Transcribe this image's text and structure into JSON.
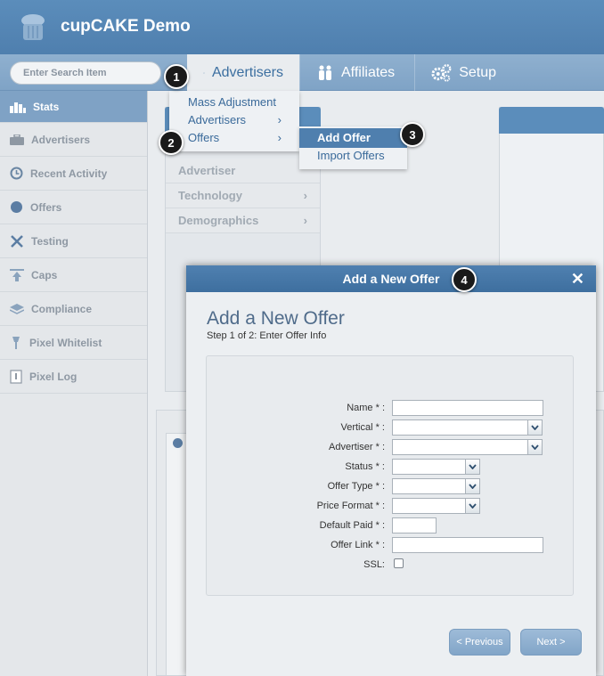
{
  "header": {
    "title": "cupCAKE Demo"
  },
  "navbar": {
    "search_placeholder": "Enter Search Item",
    "tabs": [
      {
        "label": "Advertisers",
        "icon": "megaphone-icon",
        "active": true
      },
      {
        "label": "Affiliates",
        "icon": "people-icon",
        "active": false
      },
      {
        "label": "Setup",
        "icon": "gears-icon",
        "active": false
      }
    ]
  },
  "sidebar": {
    "items": [
      {
        "label": "Stats",
        "icon": "bar-chart-icon",
        "active": true
      },
      {
        "label": "Advertisers",
        "icon": "briefcase-icon"
      },
      {
        "label": "Recent Activity",
        "icon": "clock-icon"
      },
      {
        "label": "Offers",
        "icon": "circle-icon"
      },
      {
        "label": "Testing",
        "icon": "tools-icon"
      },
      {
        "label": "Caps",
        "icon": "cap-icon"
      },
      {
        "label": "Compliance",
        "icon": "compliance-icon"
      },
      {
        "label": "Pixel Whitelist",
        "icon": "pixel-icon"
      },
      {
        "label": "Pixel Log",
        "icon": "log-icon"
      }
    ]
  },
  "filters": [
    {
      "label": "Advertiser"
    },
    {
      "label": "Technology",
      "chevron": "›"
    },
    {
      "label": "Demographics",
      "chevron": "›"
    }
  ],
  "menu": {
    "items": [
      {
        "label": "Mass Adjustment"
      },
      {
        "label": "Advertisers",
        "chevron": "›"
      },
      {
        "label": "Offers",
        "chevron": "›"
      }
    ],
    "submenu": [
      {
        "label": "Add Offer",
        "active": true
      },
      {
        "label": "Import Offers"
      }
    ]
  },
  "badges": [
    "1",
    "2",
    "3",
    "4"
  ],
  "modal": {
    "title": "Add a New Offer",
    "close": "✕",
    "heading": "Add a New Offer",
    "step": "Step 1 of 2: Enter Offer Info",
    "fields": [
      {
        "label": "Name * :",
        "kind": "input"
      },
      {
        "label": "Vertical * :",
        "kind": "select"
      },
      {
        "label": "Advertiser * :",
        "kind": "select"
      },
      {
        "label": "Status * :",
        "kind": "select"
      },
      {
        "label": "Offer Type * :",
        "kind": "select"
      },
      {
        "label": "Price Format * :",
        "kind": "select"
      },
      {
        "label": "Default Paid * :",
        "kind": "input"
      },
      {
        "label": "Offer Link * :",
        "kind": "input"
      },
      {
        "label": "SSL:",
        "kind": "checkbox"
      }
    ],
    "prev_label": "< Previous",
    "next_label": "Next >"
  }
}
